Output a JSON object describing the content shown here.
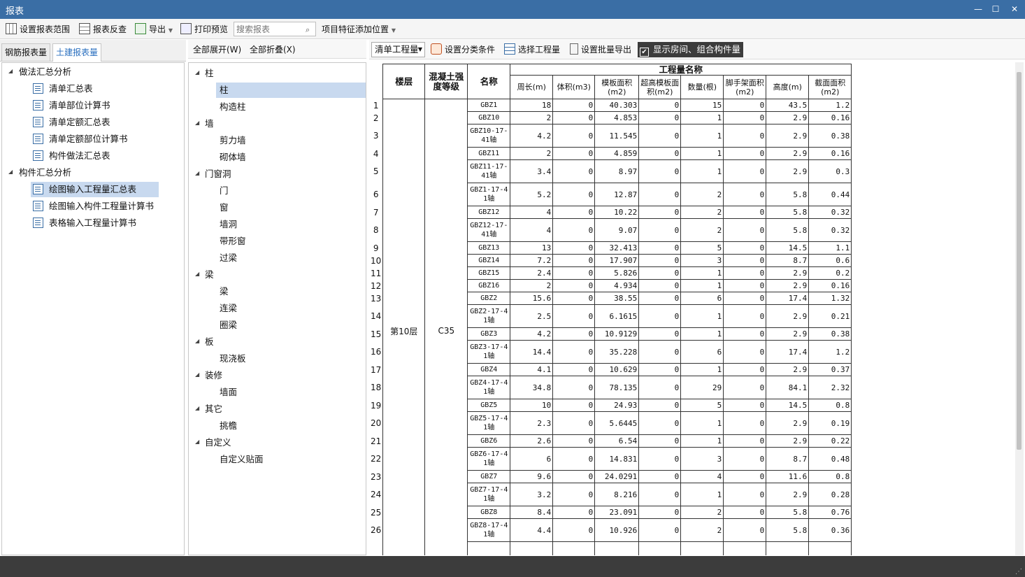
{
  "window": {
    "title": "报表",
    "controls": [
      "—",
      "☐",
      "✕"
    ]
  },
  "toolbar": {
    "set_range": "设置报表范围",
    "check": "报表反查",
    "export": "导出",
    "print_preview": "打印预览",
    "search_placeholder": "搜索报表",
    "add_feature": "项目特征添加位置"
  },
  "left_tabs": [
    "钢筋报表量",
    "土建报表量"
  ],
  "left_tree": {
    "group1": "做法汇总分析",
    "group1_items": [
      "清单汇总表",
      "清单部位计算书",
      "清单定额汇总表",
      "清单定额部位计算书",
      "构件做法汇总表"
    ],
    "group2": "构件汇总分析",
    "group2_items": [
      "绘图输入工程量汇总表",
      "绘图输入构件工程量计算书",
      "表格输入工程量计算书"
    ]
  },
  "mid_toolbar": {
    "expand": "全部展开(W)",
    "collapse": "全部折叠(X)"
  },
  "mid_tree": [
    {
      "name": "柱",
      "children": [
        "柱",
        "构造柱"
      ]
    },
    {
      "name": "墙",
      "children": [
        "剪力墙",
        "砌体墙"
      ]
    },
    {
      "name": "门窗洞",
      "children": [
        "门",
        "窗",
        "墙洞",
        "带形窗",
        "过梁"
      ]
    },
    {
      "name": "梁",
      "children": [
        "梁",
        "连梁",
        "圈梁"
      ]
    },
    {
      "name": "板",
      "children": [
        "现浇板"
      ]
    },
    {
      "name": "装修",
      "children": [
        "墙面"
      ]
    },
    {
      "name": "其它",
      "children": [
        "挑檐"
      ]
    },
    {
      "name": "自定义",
      "children": [
        "自定义贴面"
      ]
    }
  ],
  "right_toolbar": {
    "combo": "清单工程量",
    "set_cond": "设置分类条件",
    "select_qty": "选择工程量",
    "batch_export": "设置批量导出",
    "show_rooms": "显示房间、组合构件量"
  },
  "table": {
    "headers": {
      "floor": "楼层",
      "grade": "混凝土强度等级",
      "name": "名称",
      "group": "工程量名称"
    },
    "sub_headers": [
      "周长(m)",
      "体积(m3)",
      "模板面积(m2)",
      "超高模板面积(m2)",
      "数量(根)",
      "脚手架面积(m2)",
      "高度(m)",
      "截面面积(m2)"
    ],
    "floor_value": "第10层",
    "grade_value": "C35",
    "rows": [
      {
        "n": "1",
        "name": "GBZ1",
        "v": [
          "18",
          "0",
          "40.303",
          "0",
          "15",
          "0",
          "43.5",
          "1.2"
        ]
      },
      {
        "n": "2",
        "name": "GBZ10",
        "v": [
          "2",
          "0",
          "4.853",
          "0",
          "1",
          "0",
          "2.9",
          "0.16"
        ]
      },
      {
        "n": "3",
        "name": "GBZ10-17-41轴",
        "v": [
          "4.2",
          "0",
          "11.545",
          "0",
          "1",
          "0",
          "2.9",
          "0.38"
        ]
      },
      {
        "n": "4",
        "name": "GBZ11",
        "v": [
          "2",
          "0",
          "4.859",
          "0",
          "1",
          "0",
          "2.9",
          "0.16"
        ]
      },
      {
        "n": "5",
        "name": "GBZ11-17-41轴",
        "v": [
          "3.4",
          "0",
          "8.97",
          "0",
          "1",
          "0",
          "2.9",
          "0.3"
        ]
      },
      {
        "n": "6",
        "name": "GBZ1-17-41轴",
        "v": [
          "5.2",
          "0",
          "12.87",
          "0",
          "2",
          "0",
          "5.8",
          "0.44"
        ]
      },
      {
        "n": "7",
        "name": "GBZ12",
        "v": [
          "4",
          "0",
          "10.22",
          "0",
          "2",
          "0",
          "5.8",
          "0.32"
        ]
      },
      {
        "n": "8",
        "name": "GBZ12-17-41轴",
        "v": [
          "4",
          "0",
          "9.07",
          "0",
          "2",
          "0",
          "5.8",
          "0.32"
        ]
      },
      {
        "n": "9",
        "name": "GBZ13",
        "v": [
          "13",
          "0",
          "32.413",
          "0",
          "5",
          "0",
          "14.5",
          "1.1"
        ]
      },
      {
        "n": "10",
        "name": "GBZ14",
        "v": [
          "7.2",
          "0",
          "17.907",
          "0",
          "3",
          "0",
          "8.7",
          "0.6"
        ]
      },
      {
        "n": "11",
        "name": "GBZ15",
        "v": [
          "2.4",
          "0",
          "5.826",
          "0",
          "1",
          "0",
          "2.9",
          "0.2"
        ]
      },
      {
        "n": "12",
        "name": "GBZ16",
        "v": [
          "2",
          "0",
          "4.934",
          "0",
          "1",
          "0",
          "2.9",
          "0.16"
        ]
      },
      {
        "n": "13",
        "name": "GBZ2",
        "v": [
          "15.6",
          "0",
          "38.55",
          "0",
          "6",
          "0",
          "17.4",
          "1.32"
        ]
      },
      {
        "n": "14",
        "name": "GBZ2-17-41轴",
        "v": [
          "2.5",
          "0",
          "6.1615",
          "0",
          "1",
          "0",
          "2.9",
          "0.21"
        ]
      },
      {
        "n": "15",
        "name": "GBZ3",
        "v": [
          "4.2",
          "0",
          "10.9129",
          "0",
          "1",
          "0",
          "2.9",
          "0.38"
        ]
      },
      {
        "n": "16",
        "name": "GBZ3-17-41轴",
        "v": [
          "14.4",
          "0",
          "35.228",
          "0",
          "6",
          "0",
          "17.4",
          "1.2"
        ]
      },
      {
        "n": "17",
        "name": "GBZ4",
        "v": [
          "4.1",
          "0",
          "10.629",
          "0",
          "1",
          "0",
          "2.9",
          "0.37"
        ]
      },
      {
        "n": "18",
        "name": "GBZ4-17-41轴",
        "v": [
          "34.8",
          "0",
          "78.135",
          "0",
          "29",
          "0",
          "84.1",
          "2.32"
        ]
      },
      {
        "n": "19",
        "name": "GBZ5",
        "v": [
          "10",
          "0",
          "24.93",
          "0",
          "5",
          "0",
          "14.5",
          "0.8"
        ]
      },
      {
        "n": "20",
        "name": "GBZ5-17-41轴",
        "v": [
          "2.3",
          "0",
          "5.6445",
          "0",
          "1",
          "0",
          "2.9",
          "0.19"
        ]
      },
      {
        "n": "21",
        "name": "GBZ6",
        "v": [
          "2.6",
          "0",
          "6.54",
          "0",
          "1",
          "0",
          "2.9",
          "0.22"
        ]
      },
      {
        "n": "22",
        "name": "GBZ6-17-41轴",
        "v": [
          "6",
          "0",
          "14.831",
          "0",
          "3",
          "0",
          "8.7",
          "0.48"
        ]
      },
      {
        "n": "23",
        "name": "GBZ7",
        "v": [
          "9.6",
          "0",
          "24.0291",
          "0",
          "4",
          "0",
          "11.6",
          "0.8"
        ]
      },
      {
        "n": "24",
        "name": "GBZ7-17-41轴",
        "v": [
          "3.2",
          "0",
          "8.216",
          "0",
          "1",
          "0",
          "2.9",
          "0.28"
        ]
      },
      {
        "n": "25",
        "name": "GBZ8",
        "v": [
          "8.4",
          "0",
          "23.091",
          "0",
          "2",
          "0",
          "5.8",
          "0.76"
        ]
      },
      {
        "n": "26",
        "name": "GBZ8-17-41轴",
        "v": [
          "4.4",
          "0",
          "10.926",
          "0",
          "2",
          "0",
          "5.8",
          "0.36"
        ]
      }
    ]
  }
}
